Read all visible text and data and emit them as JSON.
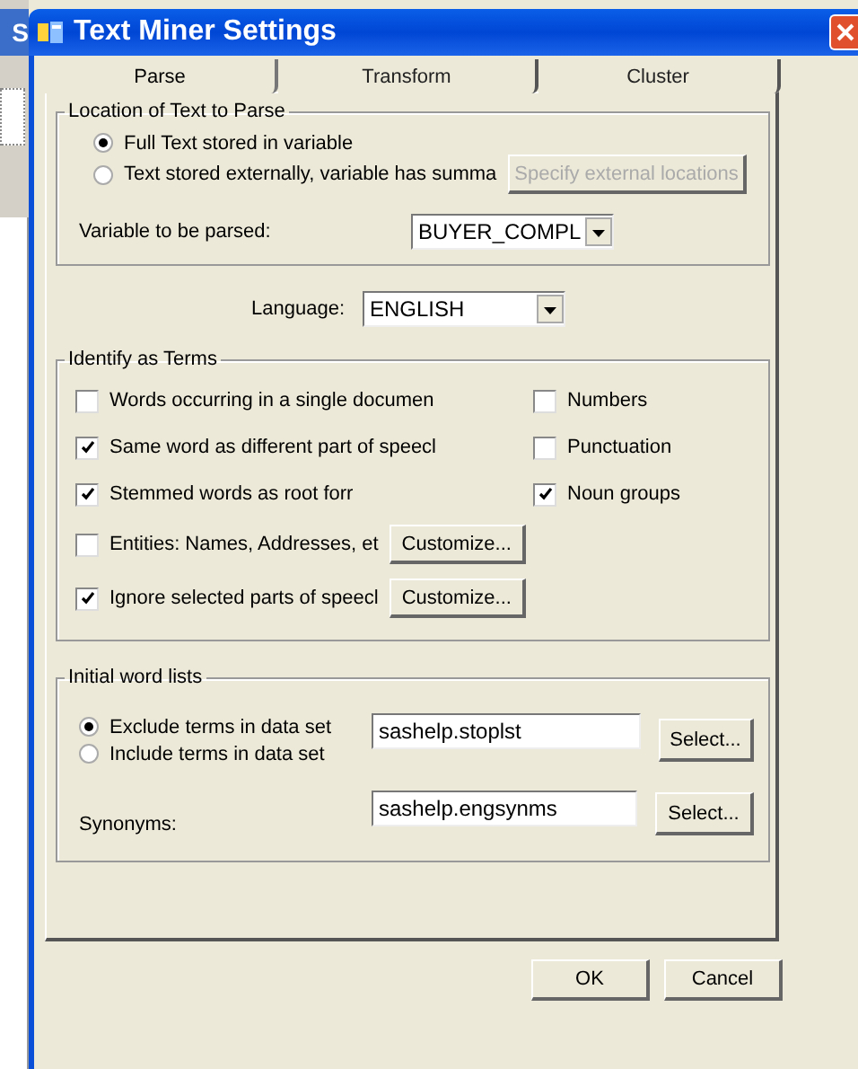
{
  "background_window": {
    "title": "S"
  },
  "window": {
    "title": "Text Miner Settings"
  },
  "tabs": [
    {
      "label": "Parse",
      "selected": true
    },
    {
      "label": "Transform",
      "selected": false
    },
    {
      "label": "Cluster",
      "selected": false
    }
  ],
  "location_group": {
    "title": "Location of Text to Parse",
    "options": [
      {
        "label": "Full Text stored in variable",
        "selected": true
      },
      {
        "label": "Text stored externally, variable has summa",
        "selected": false
      }
    ],
    "specify_button": {
      "label": "Specify external locations",
      "disabled": true
    },
    "variable_label": "Variable to be parsed:",
    "variable_value": "BUYER_COMPL"
  },
  "language": {
    "label": "Language:",
    "value": "ENGLISH"
  },
  "terms_group": {
    "title": "Identify as Terms",
    "left": [
      {
        "label": "Words occurring in a single documen",
        "checked": false
      },
      {
        "label": "Same word as different part of speecl",
        "checked": true
      },
      {
        "label": "Stemmed words as root forr",
        "checked": true
      },
      {
        "label": "Entities: Names, Addresses, et",
        "checked": false,
        "button": "Customize..."
      },
      {
        "label": "Ignore selected parts of speecl",
        "checked": true,
        "button": "Customize..."
      }
    ],
    "right": [
      {
        "label": "Numbers",
        "checked": false
      },
      {
        "label": "Punctuation",
        "checked": false
      },
      {
        "label": "Noun groups",
        "checked": true
      }
    ]
  },
  "word_lists": {
    "title": "Initial word lists",
    "options": [
      {
        "label": "Exclude terms in data set",
        "selected": true
      },
      {
        "label": "Include terms in data set",
        "selected": false
      }
    ],
    "list_value": "sashelp.stoplst",
    "list_button": "Select...",
    "synonyms_label": "Synonyms:",
    "synonyms_value": "sashelp.engsynms",
    "synonyms_button": "Select..."
  },
  "buttons": [
    "OK",
    "Cancel"
  ]
}
